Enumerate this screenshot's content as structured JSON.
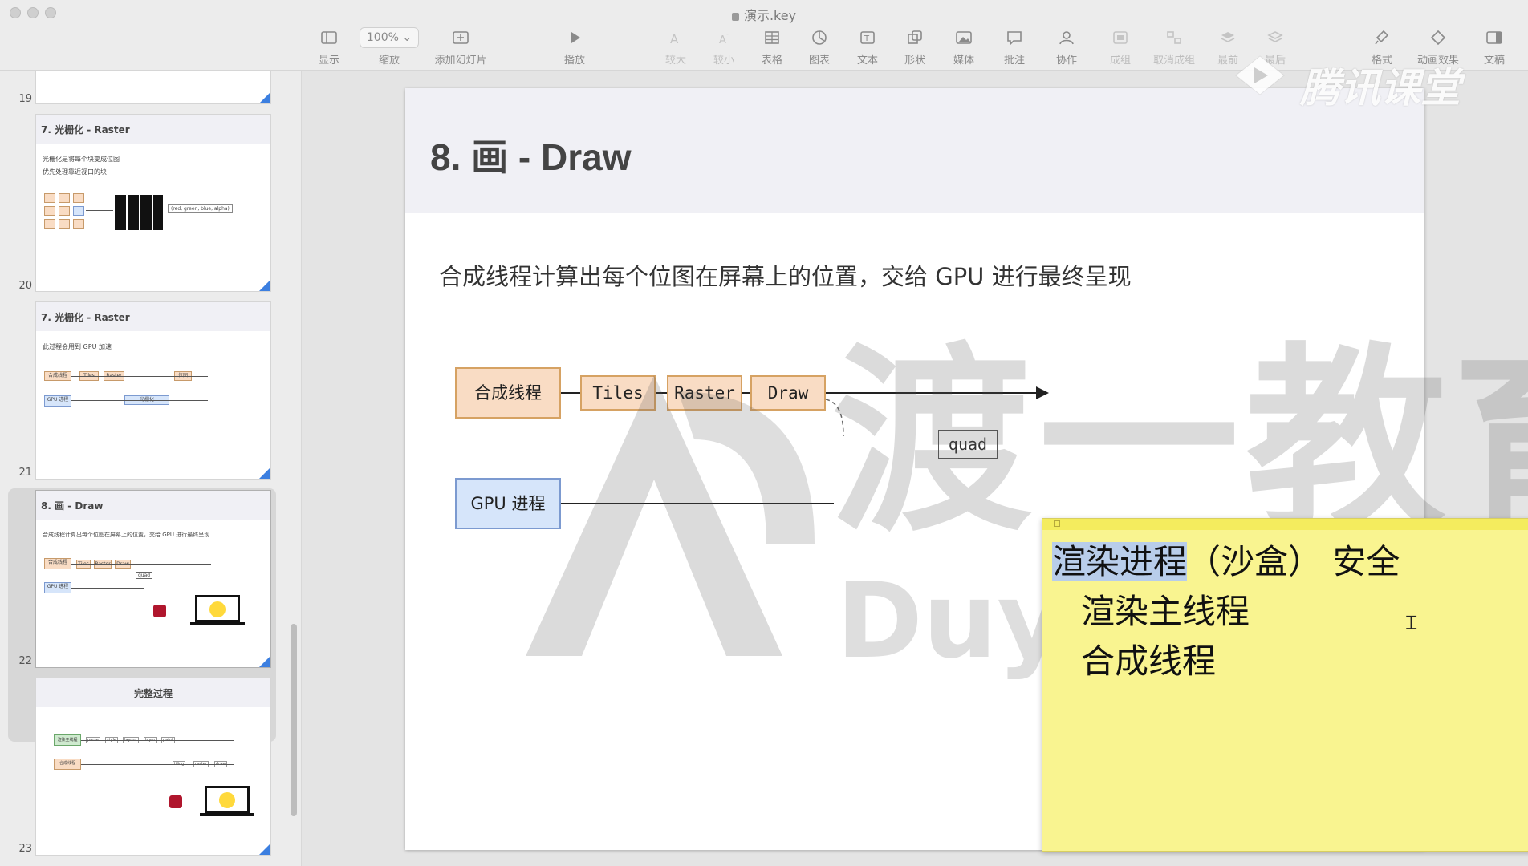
{
  "window": {
    "title": "演示.key"
  },
  "toolbar": {
    "zoom_value": "100%",
    "items": [
      {
        "label": "显示",
        "icon": "sidebar-toggle-icon"
      },
      {
        "label": "缩放",
        "icon": "zoom-select"
      },
      {
        "label": "添加幻灯片",
        "icon": "add-slide-icon"
      },
      {
        "label": "播放",
        "icon": "play-icon"
      },
      {
        "label": "较大",
        "icon": "font-larger-icon"
      },
      {
        "label": "较小",
        "icon": "font-smaller-icon"
      },
      {
        "label": "表格",
        "icon": "table-icon"
      },
      {
        "label": "图表",
        "icon": "chart-icon"
      },
      {
        "label": "文本",
        "icon": "text-icon"
      },
      {
        "label": "形状",
        "icon": "shape-icon"
      },
      {
        "label": "媒体",
        "icon": "media-icon"
      },
      {
        "label": "批注",
        "icon": "comment-icon"
      },
      {
        "label": "协作",
        "icon": "collaborate-icon"
      },
      {
        "label": "成组",
        "icon": "group-icon"
      },
      {
        "label": "取消成组",
        "icon": "ungroup-icon"
      },
      {
        "label": "最前",
        "icon": "front-icon"
      },
      {
        "label": "最后",
        "icon": "back-icon"
      },
      {
        "label": "格式",
        "icon": "format-icon"
      },
      {
        "label": "动画效果",
        "icon": "animate-icon"
      },
      {
        "label": "文稿",
        "icon": "document-icon"
      }
    ]
  },
  "sidebar": {
    "slides": [
      {
        "number": "19"
      },
      {
        "number": "20",
        "title": "7. 光栅化 - Raster",
        "lines": [
          "光栅化是将每个块变成位图",
          "优先处理靠近视口的块"
        ],
        "label": "(red, green, blue, alpha)"
      },
      {
        "number": "21",
        "title": "7. 光栅化 - Raster",
        "lines": [
          "此过程会用到 GPU 加速"
        ],
        "boxes": [
          "合成线程",
          "Tiles",
          "Raster",
          "位图",
          "GPU 进程",
          "光栅化"
        ]
      },
      {
        "number": "22",
        "title": "8. 画 - Draw",
        "lines": [
          "合成线程计算出每个位图在屏幕上的位置，交给 GPU 进行最终呈现"
        ],
        "boxes": [
          "合成线程",
          "Tiles",
          "Raster",
          "Draw",
          "quad",
          "GPU 进程"
        ]
      },
      {
        "number": "23",
        "title": "完整过程",
        "boxes": [
          "渲染主线程",
          "parse",
          "style",
          "layout",
          "layer",
          "paint",
          "合成线程",
          "tiling",
          "raster",
          "draw"
        ]
      }
    ]
  },
  "slide": {
    "title": "8. 画 - Draw",
    "subtitle": "合成线程计算出每个位图在屏幕上的位置，交给 GPU 进行最终呈现",
    "diagram": {
      "compositor": "合成线程",
      "tiles": "Tiles",
      "raster": "Raster",
      "draw": "Draw",
      "quad": "quad",
      "gpu": "GPU 进程"
    }
  },
  "sticky_note": {
    "line1_highlight": "渲染进程",
    "line1_rest": "（沙盒） 安全",
    "line2": "渲染主线程",
    "line3": "合成线程"
  },
  "watermark": {
    "brand_cn": "渡一教育",
    "brand_en": "DuyiEducation",
    "platform": "腾讯课堂"
  }
}
